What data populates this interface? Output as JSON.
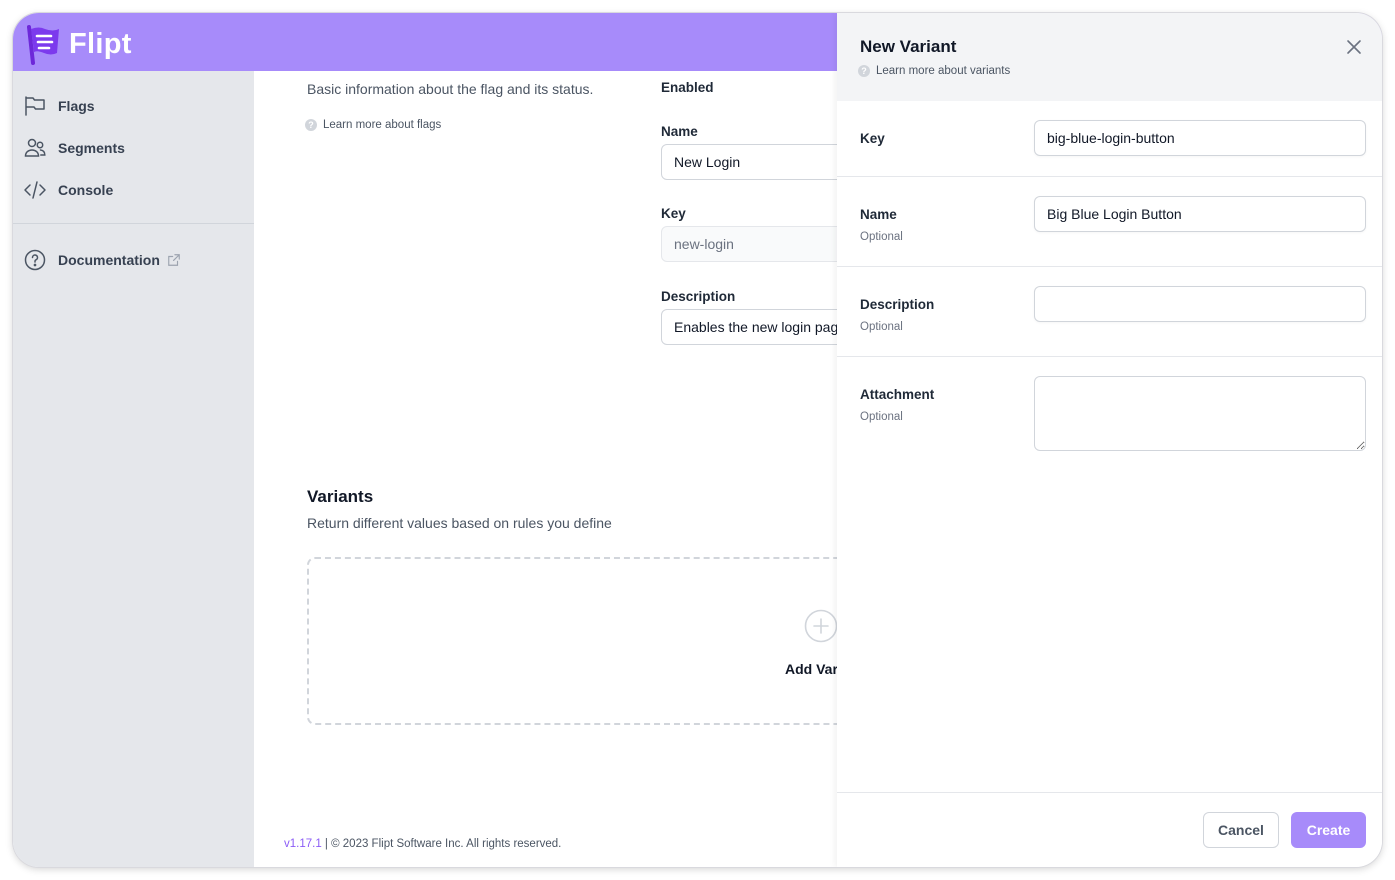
{
  "app": {
    "name": "Flipt",
    "brand_color": "#a78bfa"
  },
  "sidebar": {
    "items": [
      {
        "label": "Flags",
        "icon": "flag-icon"
      },
      {
        "label": "Segments",
        "icon": "users-icon"
      },
      {
        "label": "Console",
        "icon": "code-icon"
      }
    ],
    "documentation": {
      "label": "Documentation",
      "icon": "question-circle-icon",
      "external_icon": "external-link-icon"
    }
  },
  "main": {
    "details_description": "Basic information about the flag and its status.",
    "learn_more_flags": "Learn more about flags",
    "enabled_label": "Enabled",
    "name_label": "Name",
    "name_value": "New Login",
    "key_label": "Key",
    "key_value": "new-login",
    "description_label": "Description",
    "description_value": "Enables the new login page",
    "variants_title": "Variants",
    "variants_description": "Return different values based on rules you define",
    "add_variant_label": "Add Variant",
    "footer_version": "v1.17.1",
    "footer_text": " | © 2023 Flipt Software Inc. All rights reserved."
  },
  "panel": {
    "title": "New Variant",
    "learn_more": "Learn more about variants",
    "key_label": "Key",
    "key_value": "big-blue-login-button",
    "name_label": "Name",
    "name_value": "Big Blue Login Button",
    "optional": "Optional",
    "description_label": "Description",
    "description_value": "",
    "attachment_label": "Attachment",
    "attachment_value": "",
    "cancel_label": "Cancel",
    "create_label": "Create"
  }
}
